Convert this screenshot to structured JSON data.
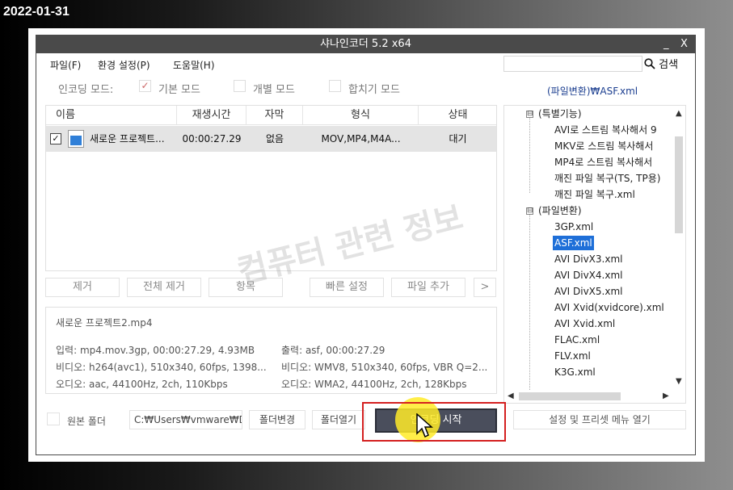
{
  "date": "2022-01-31",
  "window": {
    "title": "샤나인코더  5.2  x64",
    "minimize": "_",
    "close": "X"
  },
  "menu": {
    "file": "파일(F)",
    "settings": "환경 설정(P)",
    "help": "도움말(H)",
    "search_label": "검색"
  },
  "mode": {
    "label": "인코딩 모드:",
    "basic": "기본 모드",
    "basic_checked": true,
    "individual": "개별 모드",
    "merge": "합치기 모드",
    "check_mark": "✓"
  },
  "preset_path": "(파일변환)₩ASF.xml",
  "list": {
    "headers": [
      "이름",
      "재생시간",
      "자막",
      "형식",
      "상태"
    ],
    "rows": [
      {
        "checked": true,
        "check_mark": "✓",
        "name": "새로운 프로젝트...",
        "duration": "00:00:27.29",
        "subtitle": "없음",
        "format": "MOV,MP4,M4A...",
        "status": "대기"
      }
    ]
  },
  "buttons": {
    "remove": "제거",
    "remove_all": "전체 제거",
    "item": "항목",
    "quick_settings": "빠른 설정",
    "add_file": "파일 추가",
    "more": ">"
  },
  "info": {
    "title": "새로운 프로젝트2.mp4",
    "input": "입력: mp4.mov.3gp, 00:00:27.29, 4.93MB",
    "video": "비디오: h264(avc1), 510x340, 60fps, 1398...",
    "audio": "오디오: aac, 44100Hz, 2ch, 110Kbps",
    "output": "출력: asf, 00:00:27.29",
    "out_video": "비디오: WMV8, 510x340, 60fps, VBR Q=2...",
    "out_audio": "오디오: WMA2, 44100Hz, 2ch, 128Kbps"
  },
  "tree": {
    "group1": "(특별기능)",
    "group1_items": [
      "AVI로 스트림 복사해서 9",
      "MKV로 스트림 복사해서",
      "MP4로 스트림 복사해서",
      "깨진 파일 복구(TS, TP용)",
      "깨진 파일 복구.xml"
    ],
    "group2": "(파일변환)",
    "group2_items": [
      "3GP.xml",
      "ASF.xml",
      "AVI DivX3.xml",
      "AVI DivX4.xml",
      "AVI DivX5.xml",
      "AVI Xvid(xvidcore).xml",
      "AVI Xvid.xml",
      "FLAC.xml",
      "FLV.xml",
      "K3G.xml"
    ],
    "selected": "ASF.xml",
    "toggle": "⊟"
  },
  "bottom": {
    "source_folder": "원본 폴더",
    "path": "C:₩Users₩vmware₩D",
    "change_folder": "폴더변경",
    "open_folder": "폴더열기",
    "start_encoding": "인코딩 시작",
    "settings_menu": "설정 및 프리셋 메뉴 열기"
  },
  "watermark": "컴퓨터 관련 정보",
  "accent_colors": {
    "titlebar": "#4a4a4a",
    "selection": "#1e6fd8",
    "annotation_red": "#d42020",
    "click_highlight": "#ffeb28"
  }
}
